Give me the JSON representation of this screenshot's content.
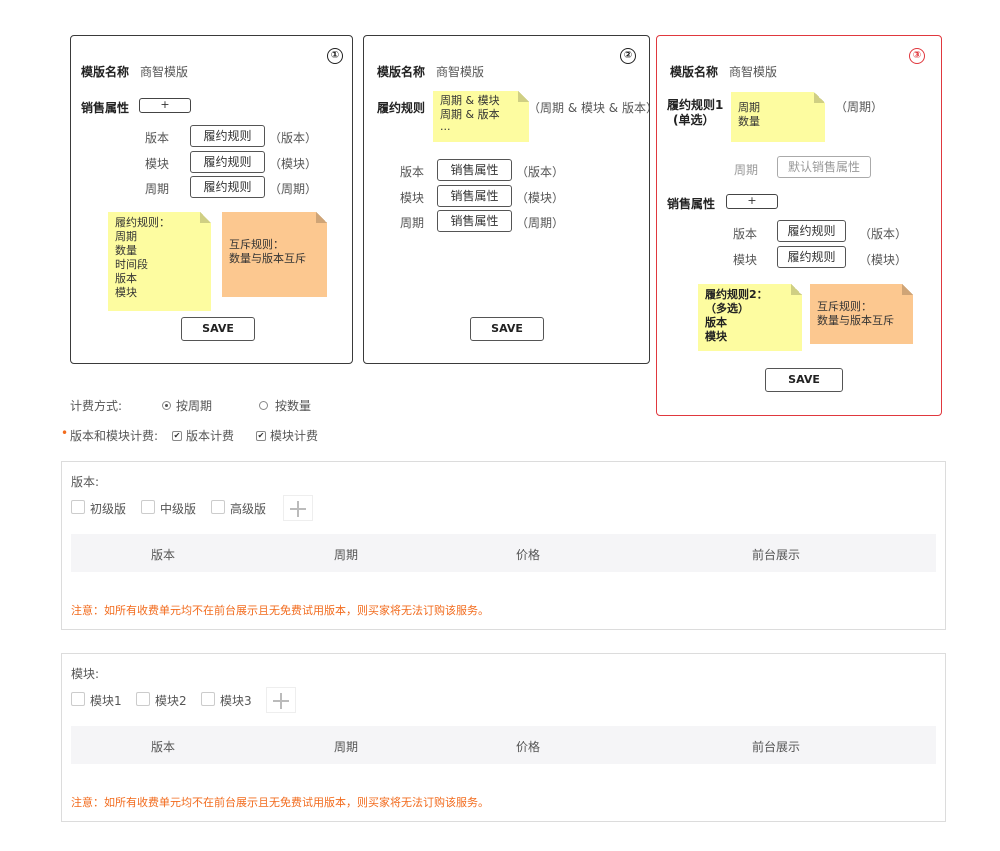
{
  "card1": {
    "num": "①",
    "template_label": "模版名称",
    "template_value": "商智模版",
    "sales_attr_label": "销售属性",
    "plus": "+",
    "rows": [
      {
        "label": "版本",
        "button": "履约规则",
        "note": "（版本）"
      },
      {
        "label": "模块",
        "button": "履约规则",
        "note": "（模块）"
      },
      {
        "label": "周期",
        "button": "履约规则",
        "note": "（周期）"
      }
    ],
    "sticky_yellow": [
      "履约规则：",
      "周期",
      "数量",
      "时间段",
      "版本",
      "模块"
    ],
    "sticky_orange": [
      "互斥规则：",
      "数量与版本互斥"
    ],
    "save": "SAVE"
  },
  "card2": {
    "num": "②",
    "template_label": "模版名称",
    "template_value": "商智模版",
    "rule_label": "履约规则",
    "sticky_yellow": [
      "周期 & 模块",
      "周期 & 版本",
      "..."
    ],
    "rule_note": "（周期 & 模块 & 版本）",
    "rows": [
      {
        "label": "版本",
        "button": "销售属性",
        "note": "（版本）"
      },
      {
        "label": "模块",
        "button": "销售属性",
        "note": "（模块）"
      },
      {
        "label": "周期",
        "button": "销售属性",
        "note": "（周期）"
      }
    ],
    "save": "SAVE"
  },
  "card3": {
    "num": "③",
    "template_label": "模版名称",
    "template_value": "商智模版",
    "rule1_label": "履约规则1",
    "rule1_sub": "(单选）",
    "sticky_rule1": [
      "周期",
      "数量"
    ],
    "rule1_note": "（周期）",
    "period_label": "周期",
    "period_button": "默认销售属性",
    "sales_attr_label": "销售属性",
    "plus": "+",
    "rows": [
      {
        "label": "版本",
        "button": "履约规则",
        "note": "（版本）"
      },
      {
        "label": "模块",
        "button": "履约规则",
        "note": "（模块）"
      }
    ],
    "sticky_rule2": [
      "履约规则2：",
      "（多选）",
      "版本",
      "模块"
    ],
    "sticky_orange": [
      "互斥规则：",
      "数量与版本互斥"
    ],
    "save": "SAVE"
  },
  "billing": {
    "label": "计费方式:",
    "options": [
      {
        "label": "按周期",
        "selected": true
      },
      {
        "label": "按数量",
        "selected": false
      }
    ]
  },
  "version_module_billing": {
    "label": "版本和模块计费:",
    "options": [
      {
        "label": "版本计费",
        "checked": true
      },
      {
        "label": "模块计费",
        "checked": true
      }
    ]
  },
  "version_panel": {
    "title": "版本:",
    "items": [
      "初级版",
      "中级版",
      "高级版"
    ],
    "columns": [
      "版本",
      "周期",
      "价格",
      "前台展示"
    ],
    "notice": "注意：如所有收费单元均不在前台展示且无免费试用版本，则买家将无法订购该服务。"
  },
  "module_panel": {
    "title": "模块:",
    "items": [
      "模块1",
      "模块2",
      "模块3"
    ],
    "columns": [
      "版本",
      "周期",
      "价格",
      "前台展示"
    ],
    "notice": "注意：如所有收费单元均不在前台展示且无免费试用版本，则买家将无法订购该服务。"
  },
  "colors": {
    "red_border": "#e0383e",
    "sticky_yellow": "#fdfca0",
    "sticky_orange": "#fcc890",
    "notice": "#f26b1d"
  }
}
